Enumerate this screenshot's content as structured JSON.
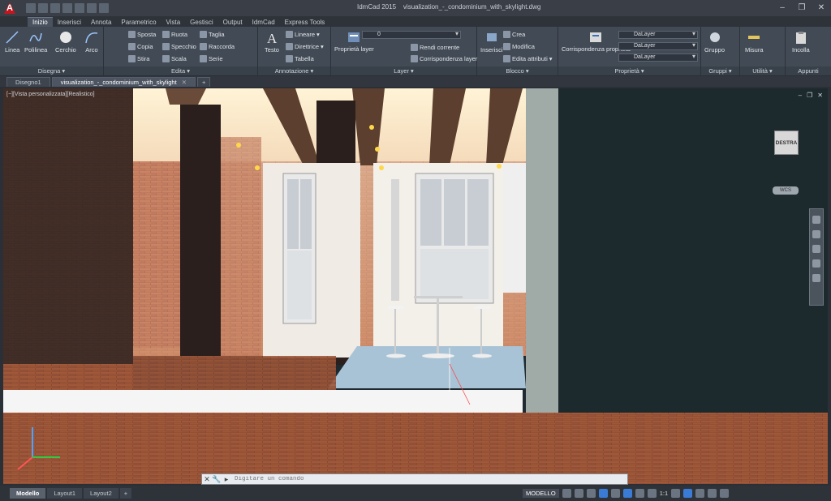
{
  "app": {
    "title": "IdmCad 2015",
    "document_title": "visualization_-_condominium_with_skylight.dwg"
  },
  "ribbon_tabs": [
    "Inizio",
    "Inserisci",
    "Annota",
    "Parametrico",
    "Vista",
    "Gestisci",
    "Output",
    "IdmCad",
    "Express Tools"
  ],
  "ribbon": {
    "draw": {
      "title": "Disegna",
      "linea": "Linea",
      "polilinea": "Polilinea",
      "cerchio": "Cerchio",
      "arco": "Arco"
    },
    "edit": {
      "title": "Edita",
      "sposta": "Sposta",
      "ruota": "Ruota",
      "taglia": "Taglia",
      "copia": "Copia",
      "specchio": "Specchio",
      "raccorda": "Raccorda",
      "stira": "Stira",
      "scala": "Scala",
      "serie": "Serie"
    },
    "annotation": {
      "title": "Annotazione",
      "testo": "Testo",
      "lineare": "Lineare",
      "direttrice": "Direttrice",
      "tabella": "Tabella"
    },
    "layer": {
      "title": "Layer",
      "proprieta_layer": "Proprietà layer",
      "layer_value": "0",
      "rendi_corrente": "Rendi corrente",
      "corrispondenza_layer": "Corrispondenza layer"
    },
    "block": {
      "title": "Blocco",
      "inserisci": "Inserisci",
      "crea": "Crea",
      "modifica": "Modifica",
      "edita_attributi": "Edita attributi"
    },
    "properties": {
      "title": "Proprietà",
      "corrispondenza": "Corrispondenza proprietà",
      "color": "DaLayer",
      "linetype": "DaLayer",
      "lineweight": "DaLayer"
    },
    "groups": {
      "title": "Gruppi",
      "gruppo": "Gruppo"
    },
    "utilities": {
      "title": "Utilità",
      "misura": "Misura"
    },
    "clipboard": {
      "title": "Appunti",
      "incolla": "Incolla"
    }
  },
  "doc_tabs": [
    "Disegno1",
    "visualization_-_condominium_with_skylight"
  ],
  "viewport": {
    "label": "[−][Vista personalizzata][Realistico]",
    "viewcube_label": "DESTRA",
    "wcs_label": "WCS"
  },
  "command_line": {
    "placeholder": "Digitare un comando"
  },
  "layout_tabs": [
    "Modello",
    "Layout1",
    "Layout2"
  ],
  "status": {
    "model": "MODELLO",
    "scale": "1:1"
  }
}
